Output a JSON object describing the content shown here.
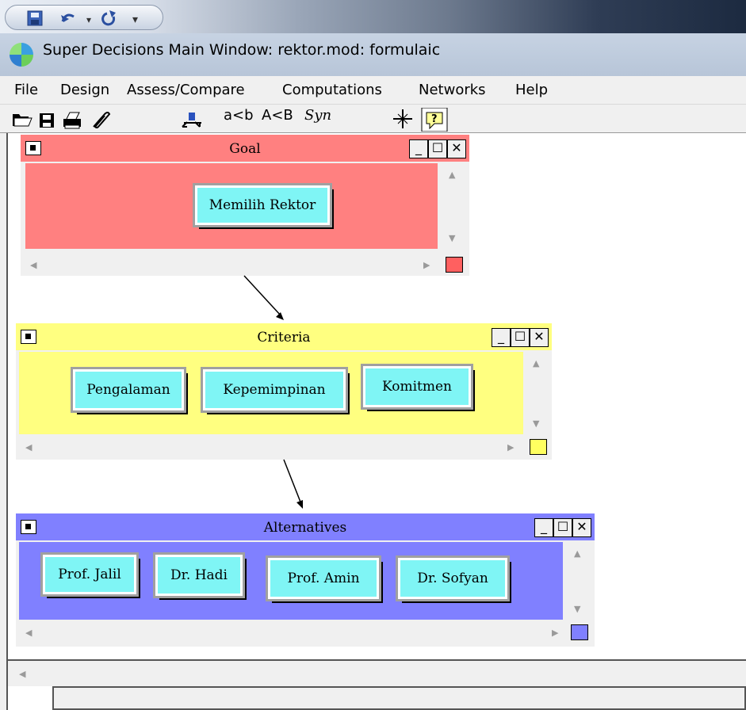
{
  "window": {
    "title": "Super Decisions Main Window: rektor.mod: formulaic"
  },
  "quick_access": {
    "icons": [
      "save-icon",
      "undo-icon",
      "redo-icon",
      "customize-dropdown-icon"
    ]
  },
  "menu": [
    "File",
    "Design",
    "Assess/Compare",
    "Computations",
    "Networks",
    "Help"
  ],
  "toolbar": {
    "icons": [
      "open-folder-icon",
      "save-disk-icon",
      "print-icon",
      "attach-icon",
      "network-arrow-icon",
      "compass-icon",
      "help-icon"
    ],
    "labels": {
      "a_less_b": "a<b",
      "A_less_B": "A<B",
      "syn": "Syn"
    }
  },
  "clusters": {
    "goal": {
      "title": "Goal",
      "color": "#ff8080",
      "nodes": [
        "Memilih Rektor"
      ]
    },
    "criteria": {
      "title": "Criteria",
      "color": "#ffff80",
      "nodes": [
        "Pengalaman",
        "Kepemimpinan",
        "Komitmen"
      ]
    },
    "alternatives": {
      "title": "Alternatives",
      "color": "#8080ff",
      "nodes": [
        "Prof. Jalil",
        "Dr. Hadi",
        "Prof. Amin",
        "Dr. Sofyan"
      ]
    }
  },
  "window_buttons": {
    "minimize": "_",
    "maximize": "☐",
    "close": "✕"
  },
  "scroll_glyphs": {
    "up": "▲",
    "down": "▼",
    "left": "◀",
    "right": "▶"
  }
}
